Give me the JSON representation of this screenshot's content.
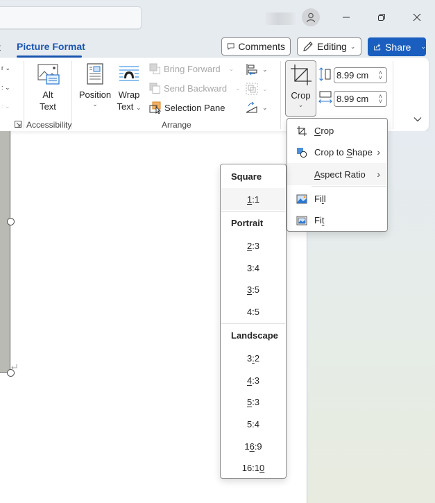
{
  "titlebar": {
    "search_placeholder": "",
    "window_controls": {
      "minimize": "minimize-icon",
      "restore": "restore-icon",
      "close": "close-icon"
    }
  },
  "tabs": {
    "partial_tab_label": "t",
    "active_tab_label": "Picture Format"
  },
  "header_buttons": {
    "comments_label": "Comments",
    "editing_label": "Editing",
    "share_label": "Share"
  },
  "ribbon": {
    "accessibility": {
      "alt_text_line1": "Alt",
      "alt_text_line2": "Text",
      "group_label": "Accessibility"
    },
    "arrange": {
      "position_label": "Position",
      "wrap_text_line1": "Wrap",
      "wrap_text_line2": "Text",
      "bring_forward_label": "Bring Forward",
      "send_backward_label": "Send Backward",
      "selection_pane_label": "Selection Pane",
      "group_label": "Arrange"
    },
    "size": {
      "crop_label": "Crop",
      "height_value": "8.99 cm",
      "width_value": "8.99 cm"
    }
  },
  "crop_menu": {
    "items": [
      {
        "label": "Crop",
        "accel": "C",
        "icon": "crop-icon",
        "has_submenu": false
      },
      {
        "label": "Crop to Shape",
        "accel": "S",
        "icon": "crop-to-shape-icon",
        "has_submenu": true
      },
      {
        "label": "Aspect Ratio",
        "accel": "A",
        "icon": "",
        "has_submenu": true,
        "highlighted": true
      },
      {
        "label": "Fill",
        "accel": "l",
        "icon": "fill-icon",
        "has_submenu": false
      },
      {
        "label": "Fit",
        "accel": "t",
        "icon": "fit-icon",
        "has_submenu": false
      }
    ]
  },
  "aspect_ratio_menu": {
    "sections": [
      {
        "header": "Square",
        "items": [
          "1:1"
        ]
      },
      {
        "header": "Portrait",
        "items": [
          "2:3",
          "3:4",
          "3:5",
          "4:5"
        ]
      },
      {
        "header": "Landscape",
        "items": [
          "3:2",
          "4:3",
          "5:3",
          "5:4",
          "16:9",
          "16:10"
        ]
      }
    ],
    "highlighted_item": "1:1"
  }
}
